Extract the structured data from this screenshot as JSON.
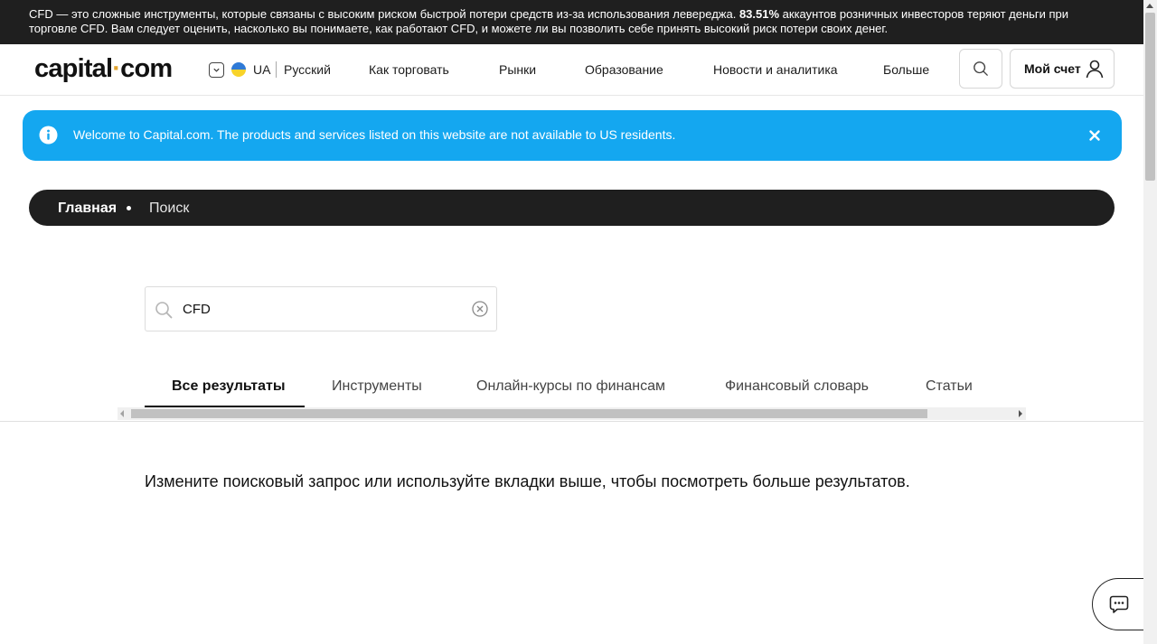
{
  "risk_warning": {
    "text_before": "CFD — это сложные инструменты, которые связаны с высоким риском быстрой потери средств из-за использования левереджа. ",
    "percentage": "83.51%",
    "text_after": " аккаунтов розничных инвесторов теряют деньги при торговле CFD. Вам следует оценить, насколько вы понимаете, как работают CFD, и можете ли вы позволить себе принять высокий риск потери своих денег."
  },
  "header": {
    "logo_left": "capital",
    "logo_dot": "·",
    "logo_right": "com",
    "lang_code": "UA",
    "lang_name": "Русский",
    "nav": [
      "Как торговать",
      "Рынки",
      "Образование",
      "Новости и аналитика",
      "Больше"
    ],
    "account_label": "Мой счет"
  },
  "notice": {
    "text": "Welcome to Capital.com. The products and services listed on this website are not available to US residents."
  },
  "breadcrumb": {
    "home": "Главная",
    "current": "Поиск"
  },
  "search": {
    "value": "CFD"
  },
  "tabs": [
    "Все результаты",
    "Инструменты",
    "Онлайн-курсы по финансам",
    "Финансовый словарь",
    "Статьи"
  ],
  "hint": "Измените поисковый запрос или используйте вкладки выше, чтобы посмотреть больше результатов.",
  "colors": {
    "risk_bar_bg": "#1f1f1f",
    "notice_bg": "#14a7f0",
    "logo_dot": "#e0a32e"
  },
  "icons": {
    "search": "search-icon",
    "user": "user-icon",
    "info": "info-icon",
    "close": "close-icon",
    "clear": "clear-icon",
    "chat": "chat-icon",
    "flag": "flag-ua-icon"
  }
}
